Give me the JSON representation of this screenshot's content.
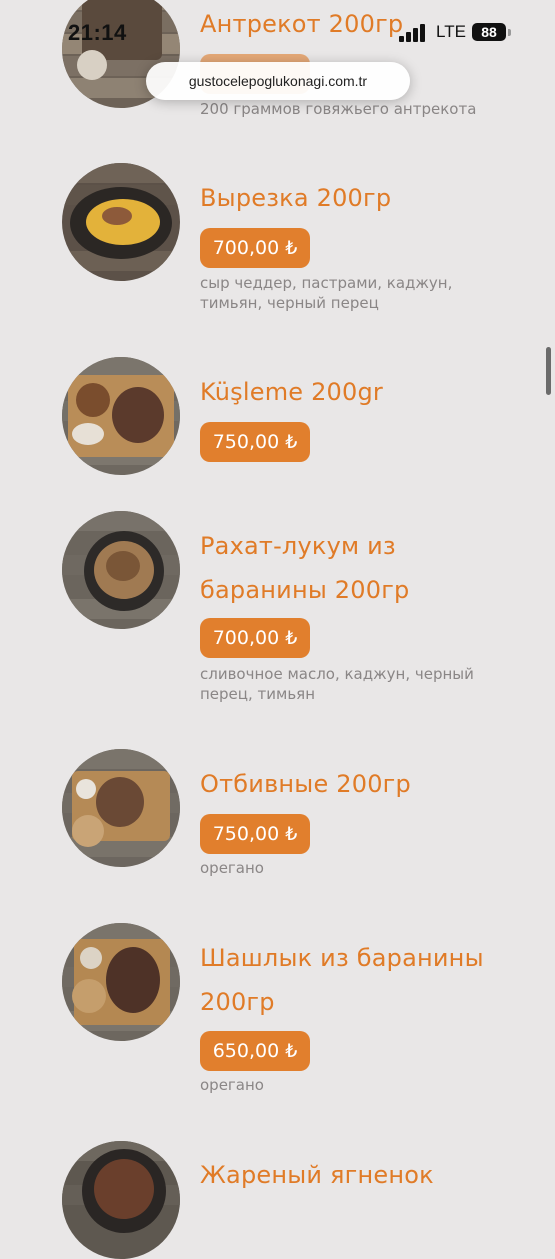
{
  "status_bar": {
    "time": "21:14",
    "network": "LTE",
    "battery": "88"
  },
  "browser": {
    "url": "gustocelepoglukonagi.com.tr"
  },
  "menu": {
    "items": [
      {
        "name": "Антрекот 200гр",
        "price": "",
        "description": "200 граммов говяжьего антрекота"
      },
      {
        "name": "Вырезка 200гр",
        "price": "700,00 ₺",
        "description": "сыр чеддер, пастрами, каджун, тимьян, черный перец"
      },
      {
        "name": "Küşleme 200gr",
        "price": "750,00 ₺",
        "description": ""
      },
      {
        "name": "Рахат-лукум из баранины 200гр",
        "price": "700,00 ₺",
        "description": "сливочное масло, каджун, черный перец, тимьян"
      },
      {
        "name": "Отбивные 200гр",
        "price": "750,00 ₺",
        "description": "орегано"
      },
      {
        "name": "Шашлык из баранины 200гр",
        "price": "650,00 ₺",
        "description": "орегано"
      },
      {
        "name": "Жареный ягненок",
        "price": "",
        "description": ""
      }
    ]
  },
  "colors": {
    "accent": "#e07b27",
    "price_badge": "#e17f2d",
    "background": "#e9e7e7"
  }
}
